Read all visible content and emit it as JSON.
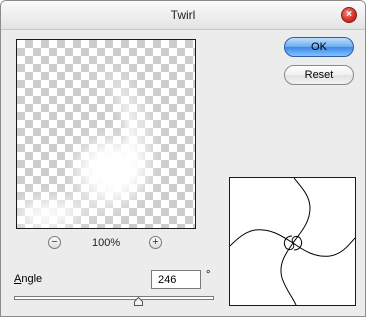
{
  "window": {
    "title": "Twirl",
    "close_glyph": "×"
  },
  "buttons": {
    "ok_label": "OK",
    "reset_label": "Reset"
  },
  "zoom": {
    "minus": "−",
    "plus": "+",
    "level": "100%"
  },
  "angle": {
    "label_first": "A",
    "label_rest": "ngle",
    "value": "246",
    "unit": "°",
    "min": -999,
    "max": 999
  },
  "icons": {
    "close": "close-icon",
    "zoom_out": "zoom-out-icon",
    "zoom_in": "zoom-in-icon",
    "slider": "slider-thumb-icon"
  },
  "colors": {
    "ok_button": "#6aaaf0",
    "close_button": "#d8322a",
    "checker": "#cdcdcd"
  }
}
